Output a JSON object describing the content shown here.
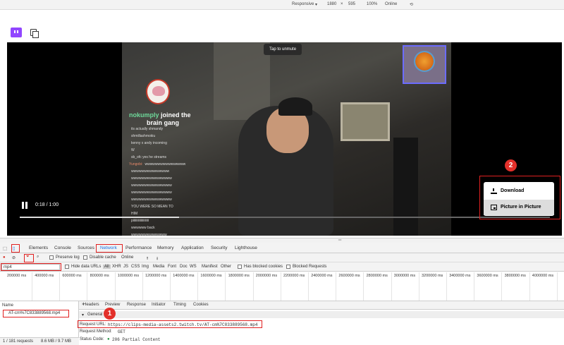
{
  "device_toolbar": {
    "device": "Responsive",
    "width": "1880",
    "x": "×",
    "height": "595",
    "zoom": "100%",
    "network": "Online"
  },
  "player": {
    "tap_to_unmute": "Tap to unmute",
    "time": "0:18 / 1:00",
    "progress_fraction": 0.3,
    "joined_name": "nokumply",
    "joined_text": " joined the",
    "joined_text2": "brain gang",
    "chat": [
      {
        "user": "",
        "msg": "its actually shmandy"
      },
      {
        "user": "",
        "msg": "shmillashmokiu"
      },
      {
        "user": "",
        "msg": "kenny x andy incoming"
      },
      {
        "user": "",
        "msg": "W"
      },
      {
        "user": "",
        "msg": "sb_ofc yes he streams"
      },
      {
        "user": "Yungobi:",
        "msg": "wwwwwwwwwwwwwwww"
      },
      {
        "user": "",
        "msg": "wwwwwwwwwwwwwww"
      },
      {
        "user": "",
        "msg": "wwwwwwwwwwwwwwww"
      },
      {
        "user": "",
        "msg": "wwwwwwwwwwwwwwww"
      },
      {
        "user": "",
        "msg": "wwwwwwwwwwwwwwww"
      },
      {
        "user": "",
        "msg": "wwwwwwwwwwwwwwww"
      },
      {
        "user": "",
        "msg": "YOU WERE SO MEAN TO"
      },
      {
        "user": "",
        "msg": "HIM"
      },
      {
        "user": "",
        "msg": "piiiiiiiiiiiiiiiiiiii"
      },
      {
        "user": "",
        "msg": "wwwwww back"
      },
      {
        "user": "",
        "msg": "wwwwwwwwwwwwww"
      }
    ],
    "menu": {
      "download": "Download",
      "pip": "Picture in Picture"
    },
    "badge1": "1",
    "badge2": "2"
  },
  "devtools": {
    "tabs": [
      "Elements",
      "Console",
      "Sources",
      "Network",
      "Performance",
      "Memory",
      "Application",
      "Security",
      "Lighthouse"
    ],
    "active_tab": "Network",
    "preserve_log": "Preserve log",
    "disable_cache": "Disable cache",
    "throttle": "Online",
    "filter_value": "mp4",
    "hide_data_urls": "Hide data URLs",
    "types": [
      "All",
      "XHR",
      "JS",
      "CSS",
      "Img",
      "Media",
      "Font",
      "Doc",
      "WS",
      "Manifest",
      "Other"
    ],
    "has_blocked_cookies": "Has blocked cookies",
    "blocked_requests": "Blocked Requests",
    "ticks": [
      "200000 ms",
      "400000 ms",
      "600000 ms",
      "800000 ms",
      "1000000 ms",
      "1200000 ms",
      "1400000 ms",
      "1600000 ms",
      "1800000 ms",
      "2000000 ms",
      "2200000 ms",
      "2400000 ms",
      "2600000 ms",
      "2800000 ms",
      "3000000 ms",
      "3200000 ms",
      "3400000 ms",
      "3600000 ms",
      "3800000 ms",
      "4000000 ms"
    ],
    "name_header": "Name",
    "request_name": "AT-cm%7C833889568.mp4",
    "status_requests": "1 / 181 requests",
    "status_size": "8.6 MB / 9.7 MB",
    "detail_tabs": [
      "Headers",
      "Preview",
      "Response",
      "Initiator",
      "Timing",
      "Cookies"
    ],
    "general": "General",
    "request_url_label": "Request URL:",
    "request_url": "https://clips-media-assets2.twitch.tv/AT-cm%7C833889568.mp4",
    "request_method_label": "Request Method:",
    "request_method": "GET",
    "status_code_label": "Status Code:",
    "status_code": "206 Partial Content"
  }
}
